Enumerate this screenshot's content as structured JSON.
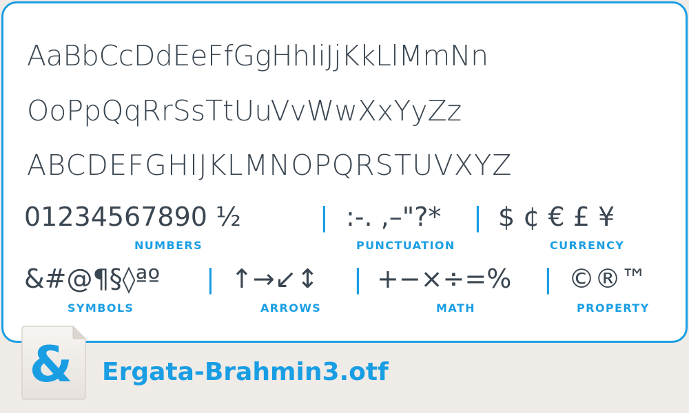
{
  "rows": {
    "mixed1": "AaBbCcDdEeFfGgHhIiJjKkLlMmNn",
    "mixed2": "OoPpQqRrSsTtUuVvWwXxYyZz",
    "upper": "ABCDEFGHIJKLMNOPQRSTUVXYZ"
  },
  "groups": {
    "numbers": {
      "glyphs": "01234567890 ½",
      "label": "NUMBERS"
    },
    "punctuation": {
      "glyphs": ":-. ,–\"?*",
      "label": "PUNCTUATION"
    },
    "currency": {
      "glyphs": "$ ¢ € £ ¥",
      "label": "CURRENCY"
    },
    "symbols": {
      "glyphs": "&#@¶§◊ªº",
      "label": "SYMBOLS"
    },
    "arrows": {
      "glyphs": "↑→↙↕",
      "label": "ARROWS"
    },
    "math": {
      "glyphs": "+−×÷=%",
      "label": "MATH"
    },
    "property": {
      "glyphs": "©®™",
      "label": "PROPERTY"
    }
  },
  "separator": "|",
  "file": {
    "name": "Ergata-Brahmin3.otf",
    "icon": "ampersand-file-icon",
    "icon_glyph": "&"
  },
  "colors": {
    "accent": "#1a9ee3",
    "text": "#3a4651",
    "background": "#efebe7"
  }
}
